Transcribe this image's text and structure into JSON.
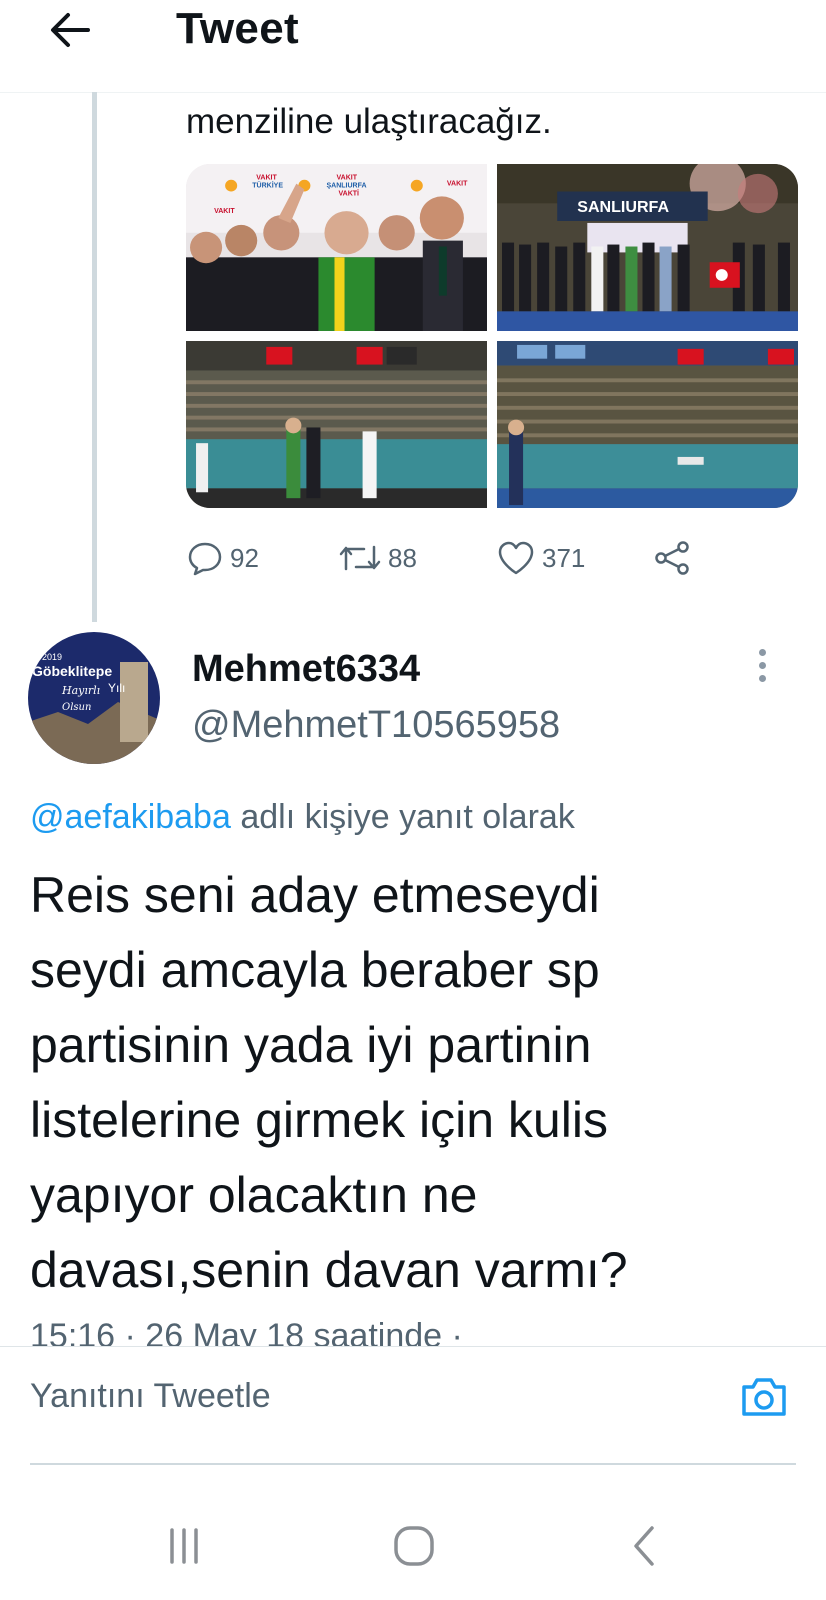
{
  "header": {
    "title": "Tweet",
    "back_icon": "arrow-left-icon"
  },
  "parent_tweet": {
    "text_tail": "menziline ulaştıracağız.",
    "photos": [
      "photo-1",
      "photo-2",
      "photo-3",
      "photo-4"
    ],
    "photo_signs": {
      "vakit": "VAKIT",
      "sanliurfa": "ŞANLIURFA",
      "turkiye": "TÜRKİYE",
      "vakti": "VAKTİ",
      "stage_banner": "SANLIURFA"
    },
    "stats": {
      "replies": "92",
      "retweets": "88",
      "likes": "371"
    }
  },
  "reply": {
    "display_name": "Mehmet6334",
    "handle": "@MehmetT10565958",
    "avatar_text": {
      "year": "2019",
      "place": "Göbeklitepe",
      "line1": "Hayırlı",
      "line2": "Yılı",
      "line3": "Olsun"
    },
    "replying_to_handle": "@aefakibaba",
    "replying_to_suffix": " adlı kişiye yanıt olarak",
    "text_lines": [
      "Reis seni aday etmeseydi",
      "seydi amcayla beraber sp",
      "partisinin yada iyi partinin",
      "listelerine girmek için kulis",
      "yapıyor olacaktın ne",
      "davası,senin davan varmı?"
    ],
    "timestamp": "15:16 · 26 May 18 saatinde ·"
  },
  "compose": {
    "placeholder": "Yanıtını Tweetle",
    "camera_icon": "camera-icon"
  },
  "colors": {
    "accent": "#1d9bf0",
    "secondary_text": "#536471",
    "primary_text": "#0f1419"
  }
}
